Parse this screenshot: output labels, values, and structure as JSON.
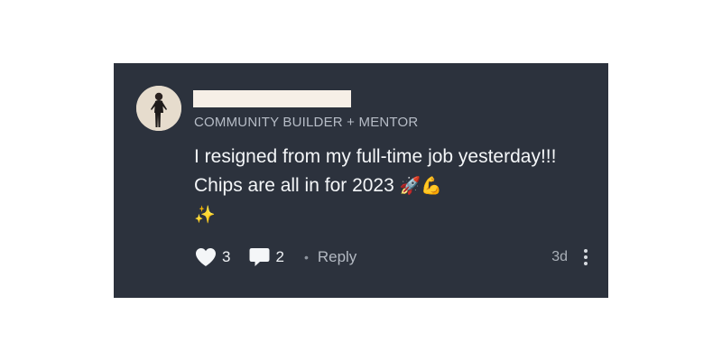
{
  "comment": {
    "author_subtitle": "COMMUNITY BUILDER + MENTOR",
    "body_text": "I resigned from my full-time job yesterday!!! Chips are all in for 2023",
    "body_emojis_line1": "🚀💪",
    "body_emojis_line2": "✨",
    "likes_count": "3",
    "comments_count": "2",
    "separator": "•",
    "reply_label": "Reply",
    "age": "3d"
  },
  "icons": {
    "like": "heart-icon",
    "comment": "speech-bubble-icon",
    "more": "vertical-ellipsis-icon"
  },
  "colors": {
    "card_background": "#2c323d",
    "text_primary": "#f4f6f8",
    "text_secondary": "#b6bcc6"
  }
}
